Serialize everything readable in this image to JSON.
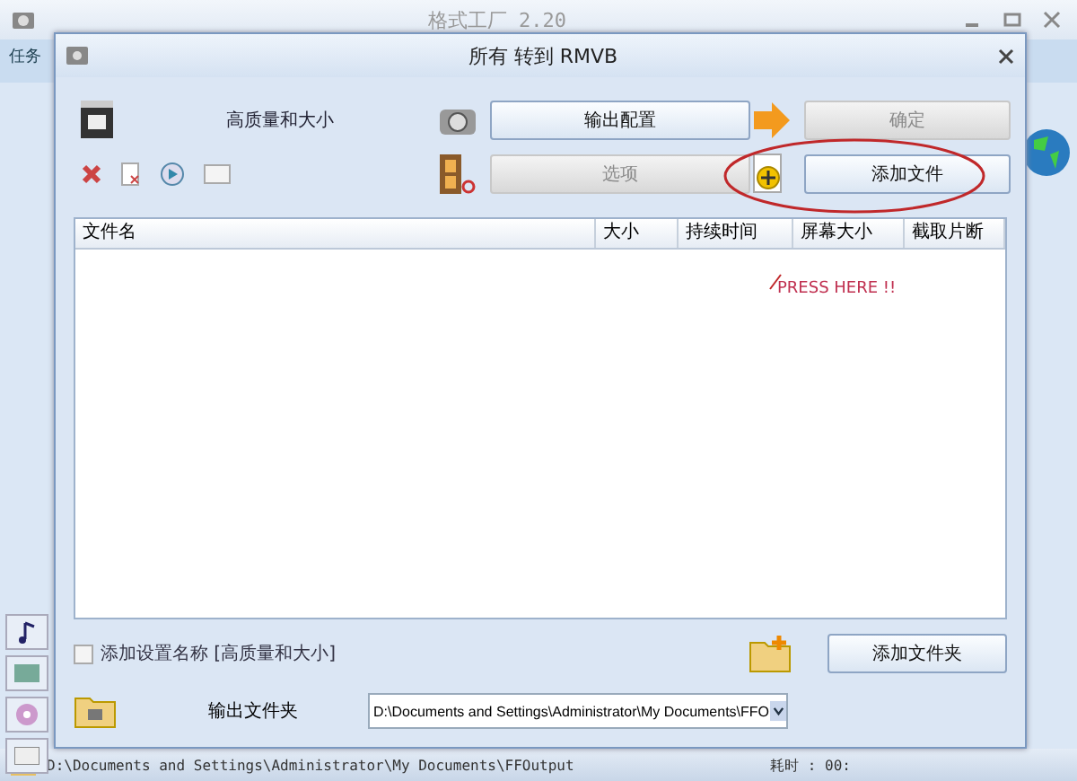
{
  "app_window": {
    "title": "格式工厂 2.20",
    "menu_label": "任务"
  },
  "dialog": {
    "title": "所有 转到 RMVB",
    "profile": "高质量和大小",
    "buttons": [
      {
        "label": "输出配置",
        "disabled": false
      },
      {
        "label": "确定",
        "disabled": true
      },
      {
        "label": "选项",
        "disabled": true
      },
      {
        "label": "添加文件",
        "disabled": false
      }
    ],
    "table": {
      "columns": [
        "文件名",
        "大小",
        "持续时间",
        "屏幕大小",
        "截取片断"
      ]
    },
    "annotation": {
      "text": "PRESS HERE !!"
    },
    "add_name": {
      "label": "添加设置名称 [高质量和大小]",
      "checked": false
    },
    "add_folder_button": "添加文件夹",
    "output_folder": {
      "label": "输出文件夹",
      "value": "D:\\Documents and Settings\\Administrator\\My Documents\\FFO"
    }
  },
  "status_bar": {
    "path": "D:\\Documents and Settings\\Administrator\\My Documents\\FFOutput",
    "elapsed": "耗时 : 00:"
  }
}
